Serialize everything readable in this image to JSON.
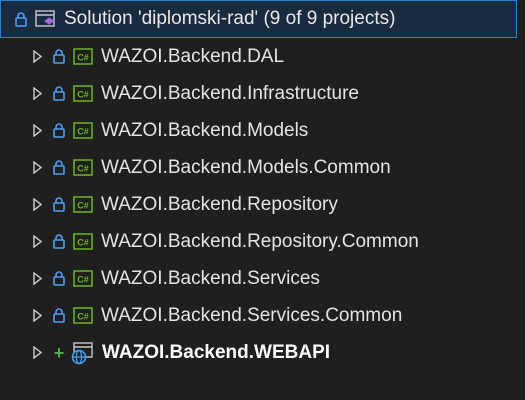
{
  "solution": {
    "label": "Solution 'diplomski-rad' (9 of 9 projects)",
    "icon": "solution-icon"
  },
  "projects": [
    {
      "label": "WAZOI.Backend.DAL",
      "icon": "csharp-project-icon",
      "bold": false
    },
    {
      "label": "WAZOI.Backend.Infrastructure",
      "icon": "csharp-project-icon",
      "bold": false
    },
    {
      "label": "WAZOI.Backend.Models",
      "icon": "csharp-project-icon",
      "bold": false
    },
    {
      "label": "WAZOI.Backend.Models.Common",
      "icon": "csharp-project-icon",
      "bold": false
    },
    {
      "label": "WAZOI.Backend.Repository",
      "icon": "csharp-project-icon",
      "bold": false
    },
    {
      "label": "WAZOI.Backend.Repository.Common",
      "icon": "csharp-project-icon",
      "bold": false
    },
    {
      "label": "WAZOI.Backend.Services",
      "icon": "csharp-project-icon",
      "bold": false
    },
    {
      "label": "WAZOI.Backend.Services.Common",
      "icon": "csharp-project-icon",
      "bold": false
    },
    {
      "label": "WAZOI.Backend.WEBAPI",
      "icon": "web-project-icon",
      "bold": true
    }
  ],
  "colors": {
    "background": "#1f1f1f",
    "selection": "#1a2b40",
    "selection_border": "#2f7fd2",
    "lock": "#4d9ff5",
    "csharp_badge": "#68b723",
    "added": "#4caf50"
  }
}
